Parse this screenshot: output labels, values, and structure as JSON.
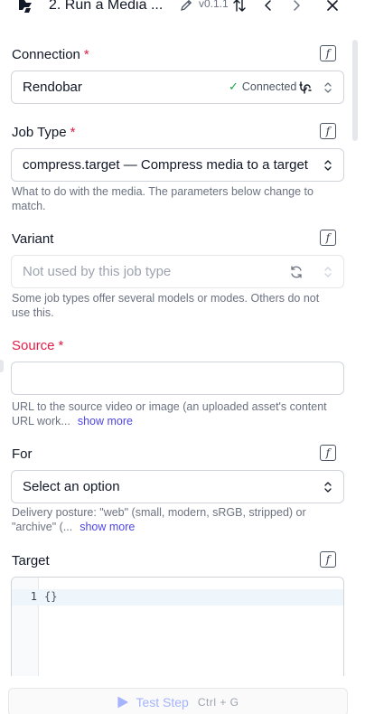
{
  "header": {
    "title": "2. Run a Media ...",
    "version": "v0.1.1"
  },
  "fields": {
    "connection": {
      "label": "Connection",
      "required_mark": "*",
      "value": "Rendobar",
      "status": "Connected"
    },
    "job_type": {
      "label": "Job Type",
      "required_mark": "*",
      "value": "compress.target — Compress media to a target",
      "help": "What to do with the media. The parameters below change to match."
    },
    "variant": {
      "label": "Variant",
      "placeholder": "Not used by this job type",
      "help": "Some job types offer several models or modes. Others do not use this."
    },
    "source": {
      "label": "Source",
      "required_mark": "*",
      "value": "",
      "help": "URL to the source video or image (an uploaded asset's content URL work...",
      "show_more": "show more"
    },
    "for": {
      "label": "For",
      "placeholder": "Select an option",
      "help": "Delivery posture: \"web\" (small, modern, sRGB, stripped) or \"archive\" (...",
      "show_more": "show more"
    },
    "target": {
      "label": "Target",
      "line_number": "1",
      "code": "{}"
    }
  },
  "footer": {
    "test_label": "Test Step",
    "shortcut": "Ctrl + G"
  },
  "colors": {
    "required": "#e11d48",
    "link": "#4f46e5",
    "connected_check": "#16a34a",
    "test_button_text": "#a5b4fc"
  }
}
